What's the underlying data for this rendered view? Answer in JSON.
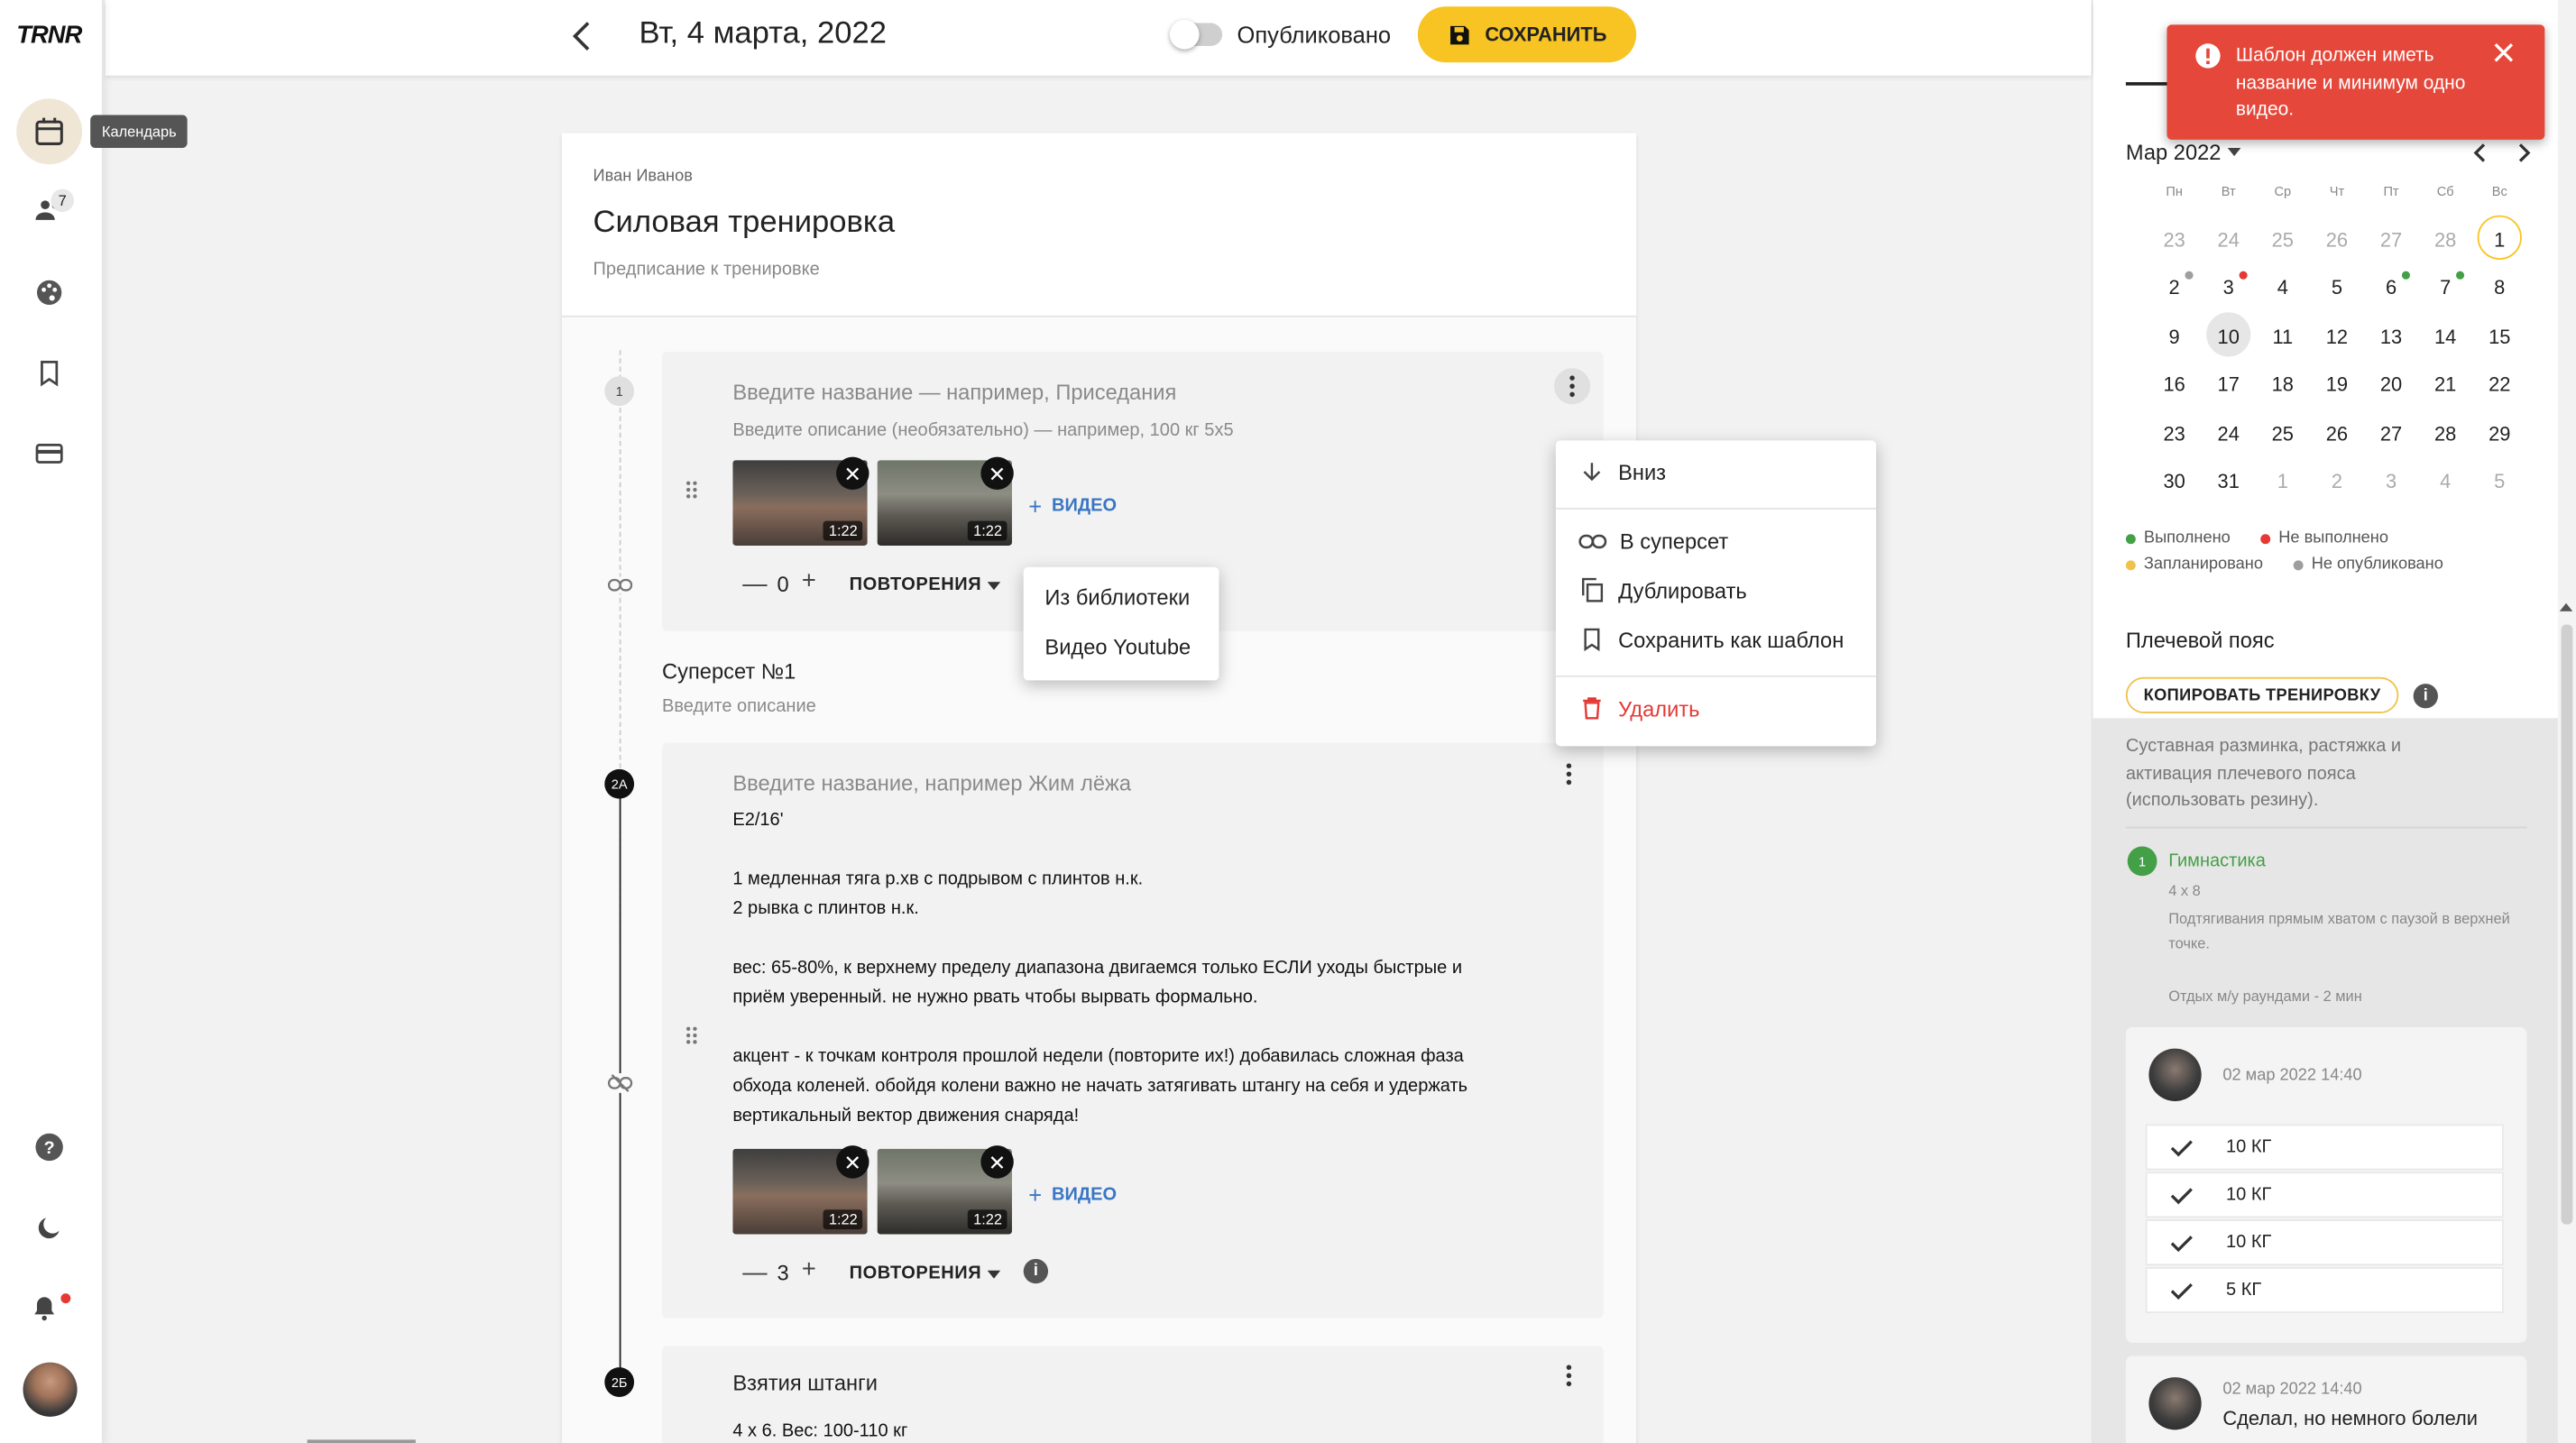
{
  "app": {
    "logo": "TRNR"
  },
  "nav": {
    "tooltip": "Календарь",
    "clients_badge": "7"
  },
  "header": {
    "date": "Вт, 4 марта, 2022",
    "published_label": "Опубликовано",
    "published": false,
    "save_label": "СОХРАНИТЬ"
  },
  "workout": {
    "author": "Иван Иванов",
    "title": "Силовая тренировка",
    "instruction_placeholder": "Предписание к тренировке"
  },
  "exercise1": {
    "number": "1",
    "name_placeholder": "Введите название — например, Приседания",
    "desc_placeholder": "Введите описание (необязательно) — например, 100 кг 5x5",
    "video_durations": [
      "1:22",
      "1:22"
    ],
    "video_button": "ВИДЕО",
    "reps_count": "0",
    "reps_label": "ПОВТОРЕНИЯ"
  },
  "video_menu": {
    "items": [
      "Из библиотеки",
      "Видео Youtube"
    ]
  },
  "context_menu": {
    "down": "Вниз",
    "superset": "В суперсет",
    "duplicate": "Дублировать",
    "save_template": "Сохранить как шаблон",
    "delete": "Удалить"
  },
  "superset": {
    "title": "Суперсет №1",
    "desc_placeholder": "Введите описание"
  },
  "exercise2a": {
    "number": "2А",
    "name_placeholder": "Введите название, например Жим лёжа",
    "lines": [
      "E2/16'",
      "1 медленная тяга р.хв с подрывом с плинтов н.к.",
      "2 рывка с плинтов н.к.",
      "вес: 65-80%, к верхнему пределу диапазона двигаемся только ЕСЛИ уходы быстрые и",
      "приём уверенный. не нужно рвать чтобы вырвать формально.",
      "акцент - к точкам контроля прошлой недели (повторите их!) добавилась сложная фаза",
      "обхода коленей. обойдя колени важно не начать затягивать штангу на себя и удержать",
      "вертикальный вектор движения снаряда!"
    ],
    "video_durations": [
      "1:22",
      "1:22"
    ],
    "video_button": "ВИДЕО",
    "reps_count": "3",
    "reps_label": "ПОВТОРЕНИЯ"
  },
  "exercise2b": {
    "number": "2Б",
    "name": "Взятия штанги",
    "desc": "4 x 6. Вес: 100-110 кг"
  },
  "toast": {
    "message": "Шаблон должен иметь название и минимум одно видео."
  },
  "calendar": {
    "month_label": "Мар 2022",
    "weekdays": [
      "Пн",
      "Вт",
      "Ср",
      "Чт",
      "Пт",
      "Сб",
      "Вс"
    ],
    "weeks": [
      [
        "23",
        "24",
        "25",
        "26",
        "27",
        "28",
        "1"
      ],
      [
        "2",
        "3",
        "4",
        "5",
        "6",
        "7",
        "8"
      ],
      [
        "9",
        "10",
        "11",
        "12",
        "13",
        "14",
        "15"
      ],
      [
        "16",
        "17",
        "18",
        "19",
        "20",
        "21",
        "22"
      ],
      [
        "23",
        "24",
        "25",
        "26",
        "27",
        "28",
        "29"
      ],
      [
        "30",
        "31",
        "1",
        "2",
        "3",
        "4",
        "5"
      ]
    ],
    "legend": {
      "done": "Выполнено",
      "not_done": "Не выполнено",
      "planned": "Запланировано",
      "unpublished": "Не опубликовано"
    },
    "colors": {
      "done": "#43a047",
      "not_done": "#e53935",
      "planned": "#f0c24a",
      "unpublished": "#9e9e9e",
      "accent": "#f8c423"
    }
  },
  "day_panel": {
    "section_title": "Плечевой пояс",
    "copy_button": "КОПИРОВАТЬ ТРЕНИРОВКУ",
    "description": "Суставная разминка, растяжка и активация плечевого пояса (использовать резину).",
    "exercise": {
      "number": "1",
      "name": "Гимнастика",
      "scheme": "4 x 8",
      "desc": "Подтягивания прямым хватом с паузой в верхней точке.",
      "rest": "Отдых м/у раундами - 2 мин"
    },
    "log1": {
      "timestamp": "02 мар 2022 14:40",
      "sets": [
        "10 КГ",
        "10 КГ",
        "10 КГ",
        "5 КГ"
      ]
    },
    "log2": {
      "timestamp": "02 мар 2022 14:40",
      "comment": "Сделал, но немного болели"
    }
  }
}
